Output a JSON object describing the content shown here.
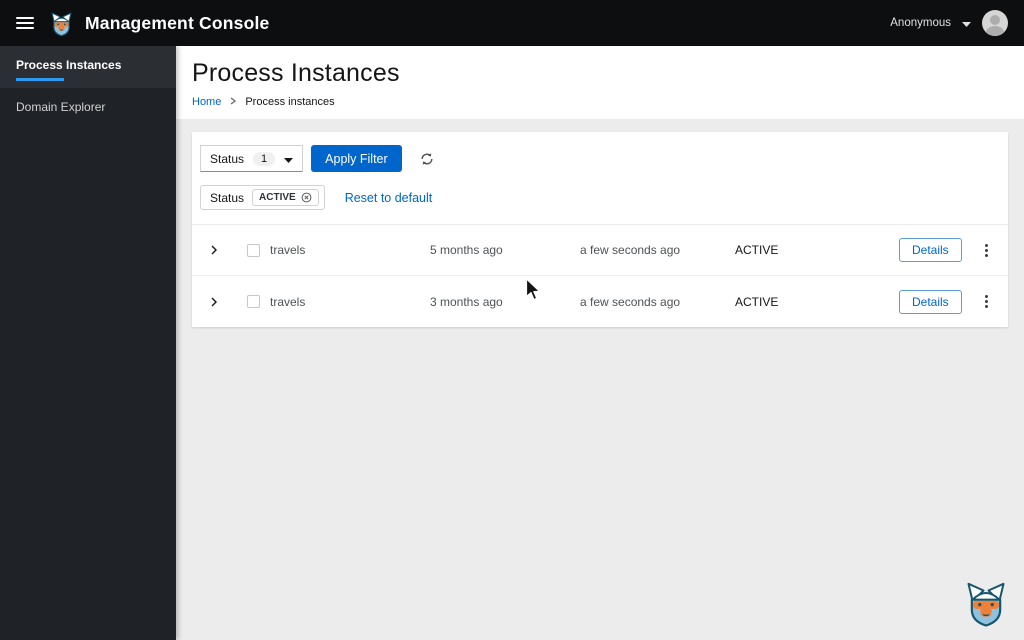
{
  "masthead": {
    "title": "Management Console",
    "user": "Anonymous"
  },
  "sidebar": {
    "items": [
      {
        "label": "Process Instances",
        "active": true
      },
      {
        "label": "Domain Explorer",
        "active": false
      }
    ]
  },
  "page": {
    "title": "Process Instances",
    "breadcrumb": {
      "home": "Home",
      "current": "Process instances"
    }
  },
  "toolbar": {
    "filter_label": "Status",
    "filter_count": "1",
    "apply_label": "Apply Filter",
    "chip_group_label": "Status",
    "chip": "ACTIVE",
    "reset_label": "Reset to default"
  },
  "rows": [
    {
      "name": "travels",
      "created": "5 months ago",
      "last_update": "a few seconds ago",
      "state": "ACTIVE",
      "details_label": "Details"
    },
    {
      "name": "travels",
      "created": "3 months ago",
      "last_update": "a few seconds ago",
      "state": "ACTIVE",
      "details_label": "Details"
    }
  ],
  "icons": {
    "hamburger": "≡",
    "caret_down": "▾",
    "breadcrumb_separator": "›",
    "refresh": "⟳",
    "chip_remove": "⊗",
    "row_expand": "›",
    "kebab": "⋮"
  },
  "colors": {
    "primary": "#0066cc",
    "nav_accent": "#2b9af3",
    "masthead_bg": "#0d0e10",
    "sidebar_bg": "#1f2226",
    "content_bg": "#ececec"
  }
}
